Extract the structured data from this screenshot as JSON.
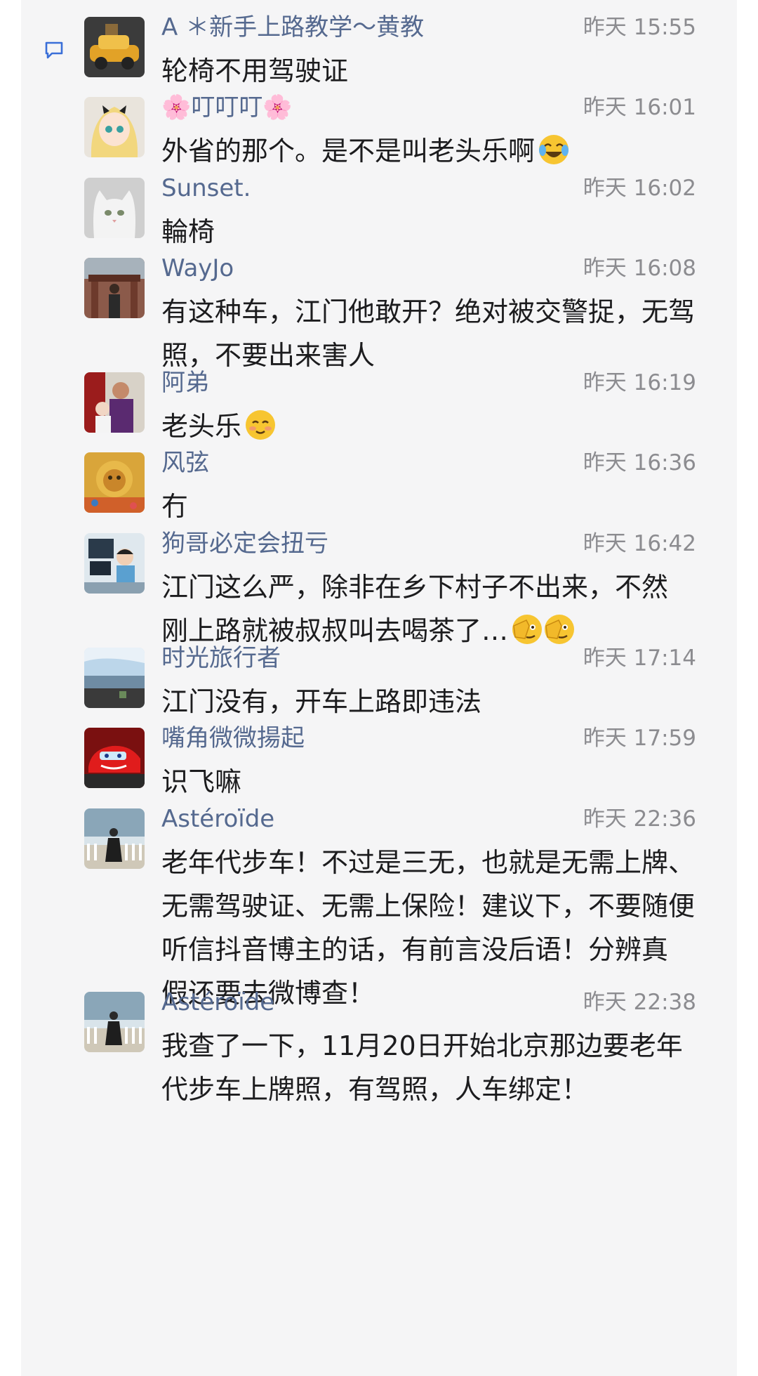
{
  "messages": [
    {
      "name": "A ＊新手上路教学～黄教",
      "time": "昨天 15:55",
      "text": "轮椅不用驾驶证",
      "emoji": []
    },
    {
      "name": "🌸叮叮叮🌸",
      "time": "昨天 16:01",
      "text": "外省的那个。是不是叫老头乐啊",
      "emoji": [
        "laugh-cry"
      ]
    },
    {
      "name": "Sunset.",
      "time": "昨天 16:02",
      "text": "輪椅",
      "emoji": []
    },
    {
      "name": "WayJo",
      "time": "昨天 16:08",
      "text": "有这种车，江门他敢开？绝对被交警捉，无驾\n照，不要出来害人",
      "emoji": []
    },
    {
      "name": "阿弟",
      "time": "昨天 16:19",
      "text": "老头乐",
      "emoji": [
        "shy-smile"
      ]
    },
    {
      "name": "风弦",
      "time": "昨天 16:36",
      "text": "冇",
      "emoji": []
    },
    {
      "name": "狗哥必定会扭亏",
      "time": "昨天 16:42",
      "text": "江门这么严，除非在乡下村子不出来，不然\n刚上路就被叔叔叫去喝茶了…",
      "emoji": [
        "face-palm",
        "face-palm"
      ]
    },
    {
      "name": "时光旅行者",
      "time": "昨天 17:14",
      "text": "江门没有，开车上路即违法",
      "emoji": []
    },
    {
      "name": "嘴角微微揚起",
      "time": "昨天 17:59",
      "text": "识飞嘛",
      "emoji": []
    },
    {
      "name": "Astéroïde",
      "time": "昨天 22:36",
      "text": "老年代步车！不过是三无，也就是无需上牌、\n无需驾驶证、无需上保险！建议下，不要随便\n听信抖音博主的话，有前言没后语！分辨真\n假还要去微博查！",
      "emoji": []
    },
    {
      "name": "Astéroïde",
      "time": "昨天 22:38",
      "text": "我查了一下，11月20日开始北京那边要老年\n代步车上牌照，有驾照，人车绑定！",
      "emoji": []
    }
  ],
  "icons": {
    "comment": "comment-icon",
    "avatars": [
      "car-cartoon-avatar",
      "anime-girl-avatar",
      "cat-avatar",
      "person-temple-avatar",
      "family-avatar",
      "lion-art-avatar",
      "child-computer-avatar",
      "seaside-avatar",
      "red-car-avatar",
      "woman-fence-avatar",
      "woman-fence-avatar"
    ]
  },
  "colors": {
    "name": "#55698f",
    "time": "#8c8c90",
    "text": "#1c1c1e",
    "background": "#f5f5f6"
  }
}
